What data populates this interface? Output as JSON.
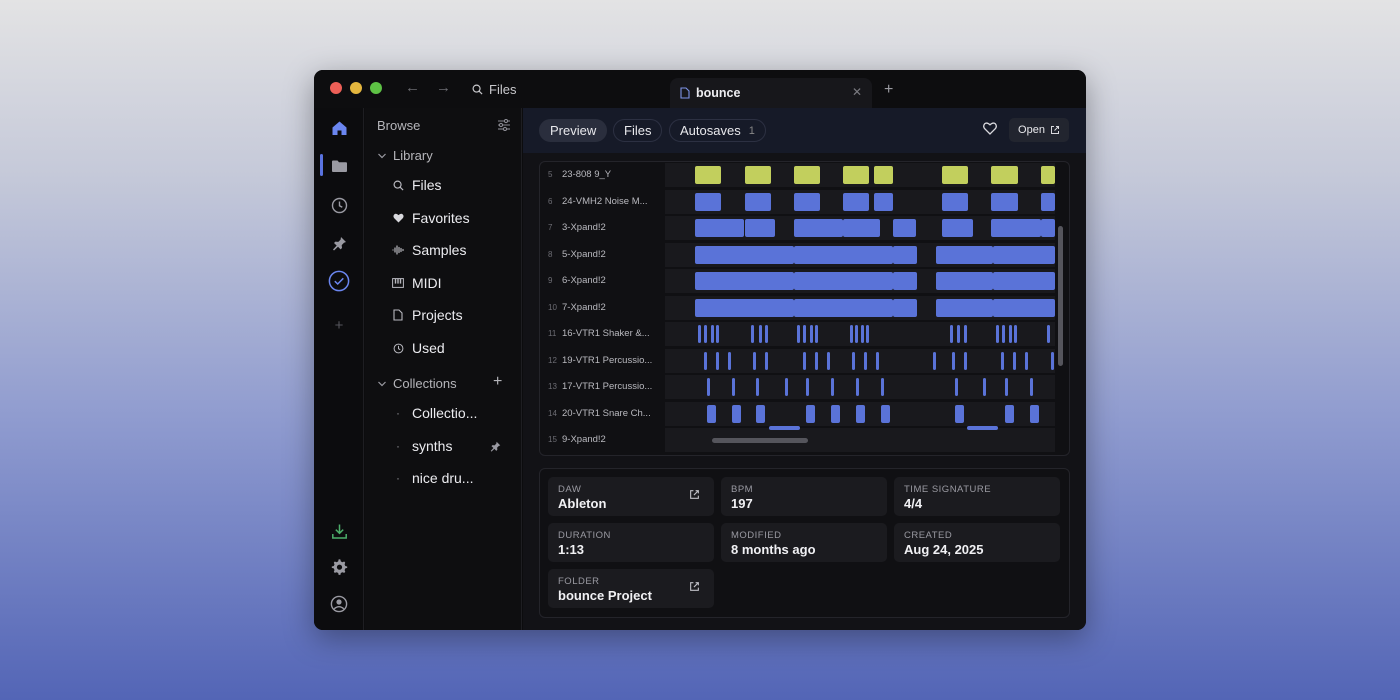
{
  "titlebar": {
    "search_label": "Files",
    "tab_title": "bounce"
  },
  "sidebar": {
    "browse_label": "Browse",
    "library_label": "Library",
    "library_items": [
      {
        "label": "Files",
        "icon": "search-icon"
      },
      {
        "label": "Favorites",
        "icon": "heart-icon"
      },
      {
        "label": "Samples",
        "icon": "waveform-icon"
      },
      {
        "label": "MIDI",
        "icon": "piano-icon"
      },
      {
        "label": "Projects",
        "icon": "document-icon"
      },
      {
        "label": "Used",
        "icon": "clock-icon"
      }
    ],
    "collections_label": "Collections",
    "collection_items": [
      {
        "label": "Collectio..."
      },
      {
        "label": "synths"
      },
      {
        "label": "nice dru..."
      }
    ]
  },
  "toolbar": {
    "tabs": [
      {
        "label": "Preview"
      },
      {
        "label": "Files"
      },
      {
        "label": "Autosaves",
        "count": "1"
      }
    ],
    "open_label": "Open"
  },
  "tracks": [
    {
      "num": "5",
      "name": "23-808 9_Y"
    },
    {
      "num": "6",
      "name": "24-VMH2 Noise M..."
    },
    {
      "num": "7",
      "name": "3-Xpand!2"
    },
    {
      "num": "8",
      "name": "5-Xpand!2"
    },
    {
      "num": "9",
      "name": "6-Xpand!2"
    },
    {
      "num": "10",
      "name": "7-Xpand!2"
    },
    {
      "num": "11",
      "name": "16-VTR1 Shaker &..."
    },
    {
      "num": "12",
      "name": "19-VTR1 Percussio..."
    },
    {
      "num": "13",
      "name": "17-VTR1 Percussio..."
    },
    {
      "num": "14",
      "name": "20-VTR1 Snare Ch..."
    },
    {
      "num": "15",
      "name": "9-Xpand!2"
    }
  ],
  "info": {
    "daw": {
      "label": "DAW",
      "value": "Ableton"
    },
    "bpm": {
      "label": "BPM",
      "value": "197"
    },
    "time_signature": {
      "label": "TIME SIGNATURE",
      "value": "4/4"
    },
    "duration": {
      "label": "DURATION",
      "value": "1:13"
    },
    "modified": {
      "label": "MODIFIED",
      "value": "8 months ago"
    },
    "created": {
      "label": "CREATED",
      "value": "Aug 24, 2025"
    },
    "folder": {
      "label": "FOLDER",
      "value": "bounce Project"
    }
  },
  "colors": {
    "clip_blue": "#5a73d8",
    "clip_yellow": "#c2cf5d",
    "accent": "#5a73e0"
  }
}
